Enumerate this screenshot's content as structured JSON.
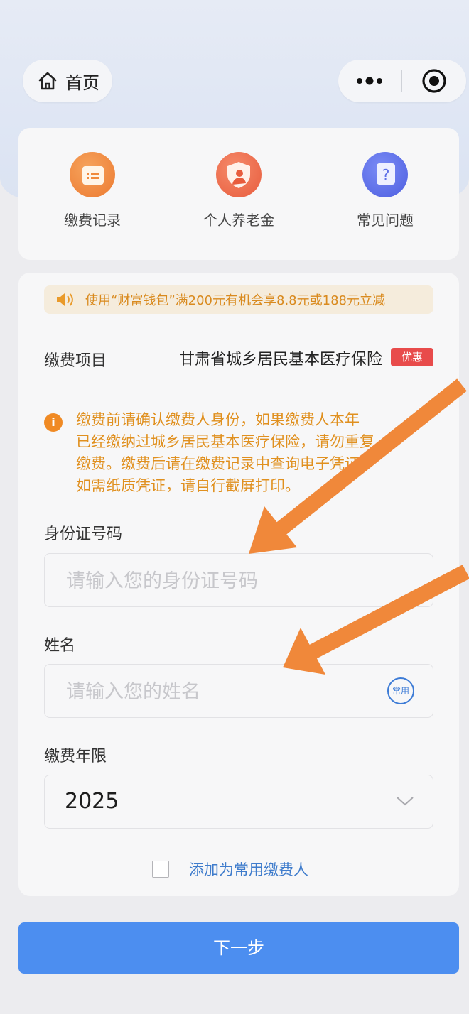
{
  "nav": {
    "home_label": "首页"
  },
  "shortcuts": [
    {
      "label": "缴费记录",
      "icon": "receipt-icon",
      "color": "#f08a3c"
    },
    {
      "label": "个人养老金",
      "icon": "pension-shield-icon",
      "color": "#ec6b4a"
    },
    {
      "label": "常见问题",
      "icon": "question-icon",
      "color": "#5d6fe8"
    }
  ],
  "notice": {
    "text": "使用“财富钱包”满200元有机会享8.8元或188元立减"
  },
  "payment_item": {
    "label": "缴费项目",
    "value": "甘肃省城乡居民基本医疗保险",
    "badge": "优惠"
  },
  "warning": {
    "line1": "缴费前请确认缴费人身份，如果缴费人本年",
    "line2": "已经缴纳过城乡居民基本医疗保险，请勿重复",
    "line3": "缴费。缴费后请在缴费记录中查询电子凭证，",
    "line4": "如需纸质凭证，请自行截屏打印。"
  },
  "id_field": {
    "label": "身份证号码",
    "placeholder": "请输入您的身份证号码"
  },
  "name_field": {
    "label": "姓名",
    "placeholder": "请输入您的姓名",
    "often_label": "常用"
  },
  "year_field": {
    "label": "缴费年限",
    "value": "2025"
  },
  "add_payer": {
    "label": "添加为常用缴费人"
  },
  "next_button": {
    "label": "下一步"
  },
  "colors": {
    "accent": "#4c8ef0",
    "warning": "#e0901f",
    "badge": "#e84b4b",
    "arrow": "#f0883a"
  }
}
